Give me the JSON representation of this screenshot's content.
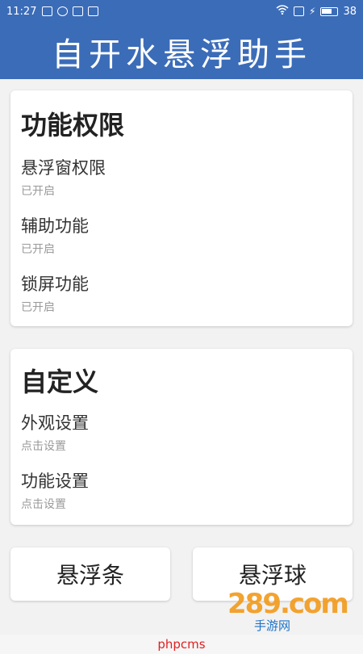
{
  "statusbar": {
    "time": "11:27",
    "battery": "38"
  },
  "app": {
    "title": "自开水悬浮助手"
  },
  "section_permissions": {
    "title": "功能权限",
    "items": [
      {
        "label": "悬浮窗权限",
        "status": "已开启"
      },
      {
        "label": "辅助功能",
        "status": "已开启"
      },
      {
        "label": "锁屏功能",
        "status": "已开启"
      }
    ]
  },
  "section_custom": {
    "title": "自定义",
    "items": [
      {
        "label": "外观设置",
        "status": "点击设置"
      },
      {
        "label": "功能设置",
        "status": "点击设置"
      }
    ]
  },
  "buttons": {
    "float_bar": "悬浮条",
    "float_ball": "悬浮球"
  },
  "watermark": {
    "logo": "289.com",
    "sub": "手游网",
    "footer": "phpcms"
  }
}
